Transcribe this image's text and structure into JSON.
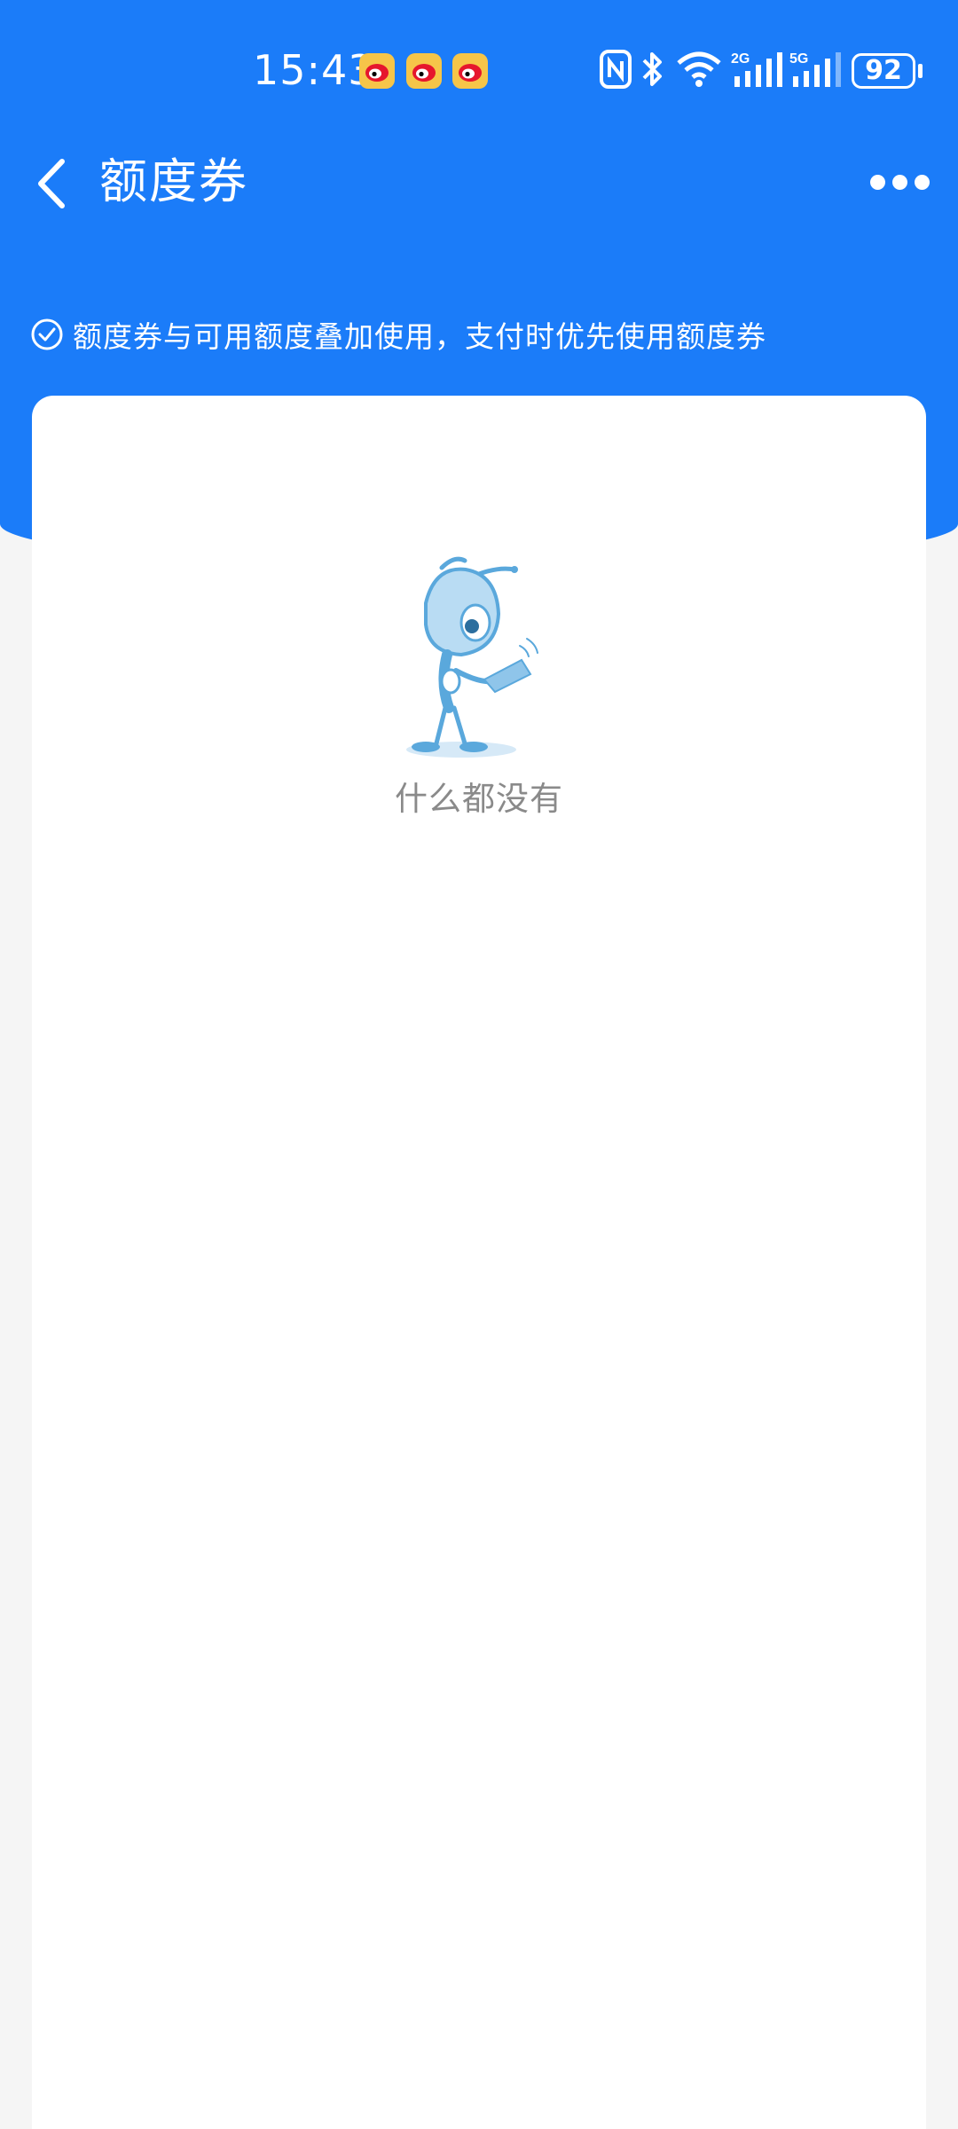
{
  "status_bar": {
    "time": "15:43",
    "notification_icons": [
      "weibo-icon",
      "weibo-icon",
      "weibo-icon"
    ],
    "network_2g": "2G",
    "network_5g": "5G",
    "battery": "92"
  },
  "nav": {
    "title": "额度券",
    "back_icon": "chevron-left-icon",
    "more_icon": "more-dots-icon"
  },
  "tip": {
    "icon": "check-circle-icon",
    "text": "额度券与可用额度叠加使用，支付时优先使用额度券"
  },
  "empty_state": {
    "illustration": "ant-mascot-illustration",
    "text": "什么都没有"
  },
  "colors": {
    "primary": "#1b7cf9",
    "background": "#f5f5f5",
    "card": "#ffffff",
    "empty_text": "#8a8a8a"
  }
}
